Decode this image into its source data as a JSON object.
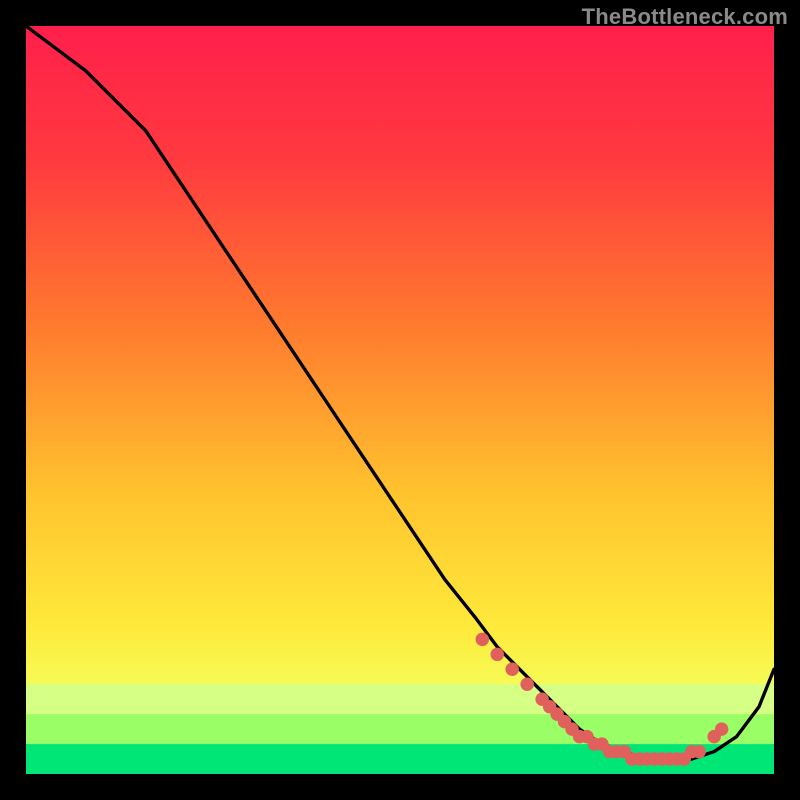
{
  "watermark": "TheBottleneck.com",
  "colors": {
    "bg": "#000000",
    "curve": "#000000",
    "marker": "#e0615c",
    "band_outer": "#d5ff85",
    "band_mid": "#9aff66",
    "band_inner": "#00e676",
    "grad_top": "#ff1f4b",
    "grad_bottom": "#f7ff6a"
  },
  "chart_data": {
    "type": "line",
    "title": "",
    "xlabel": "",
    "ylabel": "",
    "xlim": [
      0,
      100
    ],
    "ylim": [
      0,
      100
    ],
    "gradient_stops": [
      {
        "offset": 0.0,
        "color": "#ff1f4b"
      },
      {
        "offset": 0.18,
        "color": "#ff3a3f"
      },
      {
        "offset": 0.4,
        "color": "#ff7a2e"
      },
      {
        "offset": 0.62,
        "color": "#ffc22e"
      },
      {
        "offset": 0.8,
        "color": "#ffe93a"
      },
      {
        "offset": 0.9,
        "color": "#f4ff5c"
      },
      {
        "offset": 1.0,
        "color": "#e9ff78"
      }
    ],
    "series": [
      {
        "name": "bottleneck-curve",
        "x": [
          0,
          4,
          8,
          12,
          16,
          20,
          24,
          28,
          32,
          36,
          40,
          44,
          48,
          52,
          56,
          60,
          63,
          67,
          71,
          74,
          77,
          80,
          83,
          86,
          89,
          92,
          95,
          98,
          100
        ],
        "y": [
          100,
          97,
          94,
          90,
          86,
          80,
          74,
          68,
          62,
          56,
          50,
          44,
          38,
          32,
          26,
          21,
          17,
          13,
          9,
          6,
          4,
          3,
          2,
          2,
          2,
          3,
          5,
          9,
          14
        ]
      }
    ],
    "markers": {
      "name": "highlight-dots",
      "x": [
        61,
        63,
        65,
        67,
        69,
        70,
        71,
        72,
        73,
        74,
        75,
        76,
        77,
        78,
        79,
        80,
        81,
        82,
        83,
        84,
        85,
        86,
        87,
        88,
        89,
        90,
        92,
        93
      ],
      "y": [
        18,
        16,
        14,
        12,
        10,
        9,
        8,
        7,
        6,
        5,
        5,
        4,
        4,
        3,
        3,
        3,
        2,
        2,
        2,
        2,
        2,
        2,
        2,
        2,
        3,
        3,
        5,
        6
      ]
    },
    "bottom_bands": [
      {
        "y": 8,
        "color_key": "band_outer"
      },
      {
        "y": 4,
        "color_key": "band_mid"
      },
      {
        "y": 0,
        "color_key": "band_inner"
      }
    ]
  }
}
